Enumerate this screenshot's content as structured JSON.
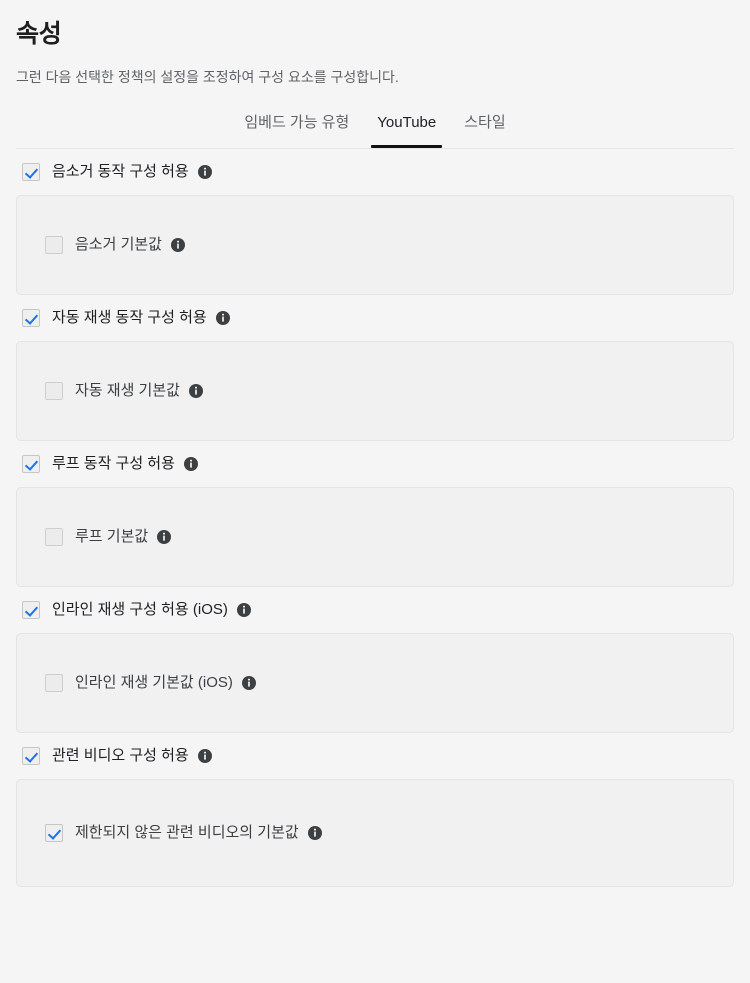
{
  "header": {
    "title": "속성",
    "subtitle": "그런 다음 선택한 정책의 설정을 조정하여 구성 요소를 구성합니다."
  },
  "tabs": [
    {
      "label": "임베드 가능 유형",
      "active": false
    },
    {
      "label": "YouTube",
      "active": true
    },
    {
      "label": "스타일",
      "active": false
    }
  ],
  "settings": [
    {
      "parent": {
        "label": "음소거 동작 구성 허용",
        "checked": true,
        "info": "info-icon"
      },
      "child": {
        "label": "음소거 기본값",
        "checked": false,
        "info": "info-icon"
      }
    },
    {
      "parent": {
        "label": "자동 재생 동작 구성 허용",
        "checked": true,
        "info": "info-icon"
      },
      "child": {
        "label": "자동 재생 기본값",
        "checked": false,
        "info": "info-icon"
      }
    },
    {
      "parent": {
        "label": "루프 동작 구성 허용",
        "checked": true,
        "info": "info-icon"
      },
      "child": {
        "label": "루프 기본값",
        "checked": false,
        "info": "info-icon"
      }
    },
    {
      "parent": {
        "label": "인라인 재생 구성 허용 (iOS)",
        "checked": true,
        "info": "info-icon"
      },
      "child": {
        "label": "인라인 재생 기본값 (iOS)",
        "checked": false,
        "info": "info-icon"
      }
    },
    {
      "parent": {
        "label": "관련 비디오 구성 허용",
        "checked": true,
        "info": "info-icon"
      },
      "child": {
        "label": "제한되지 않은 관련 비디오의 기본값",
        "checked": true,
        "info": "info-icon"
      }
    }
  ],
  "colors": {
    "page_background": "#f5f5f5",
    "panel_background": "#f1f1f1",
    "panel_border": "#e4e4e4",
    "checkmark_blue": "#1a73e8",
    "active_tab_underline": "#111111",
    "inactive_tab_text": "#5f6368",
    "title_text": "#1f1f1f",
    "info_icon": "#3c4043"
  }
}
